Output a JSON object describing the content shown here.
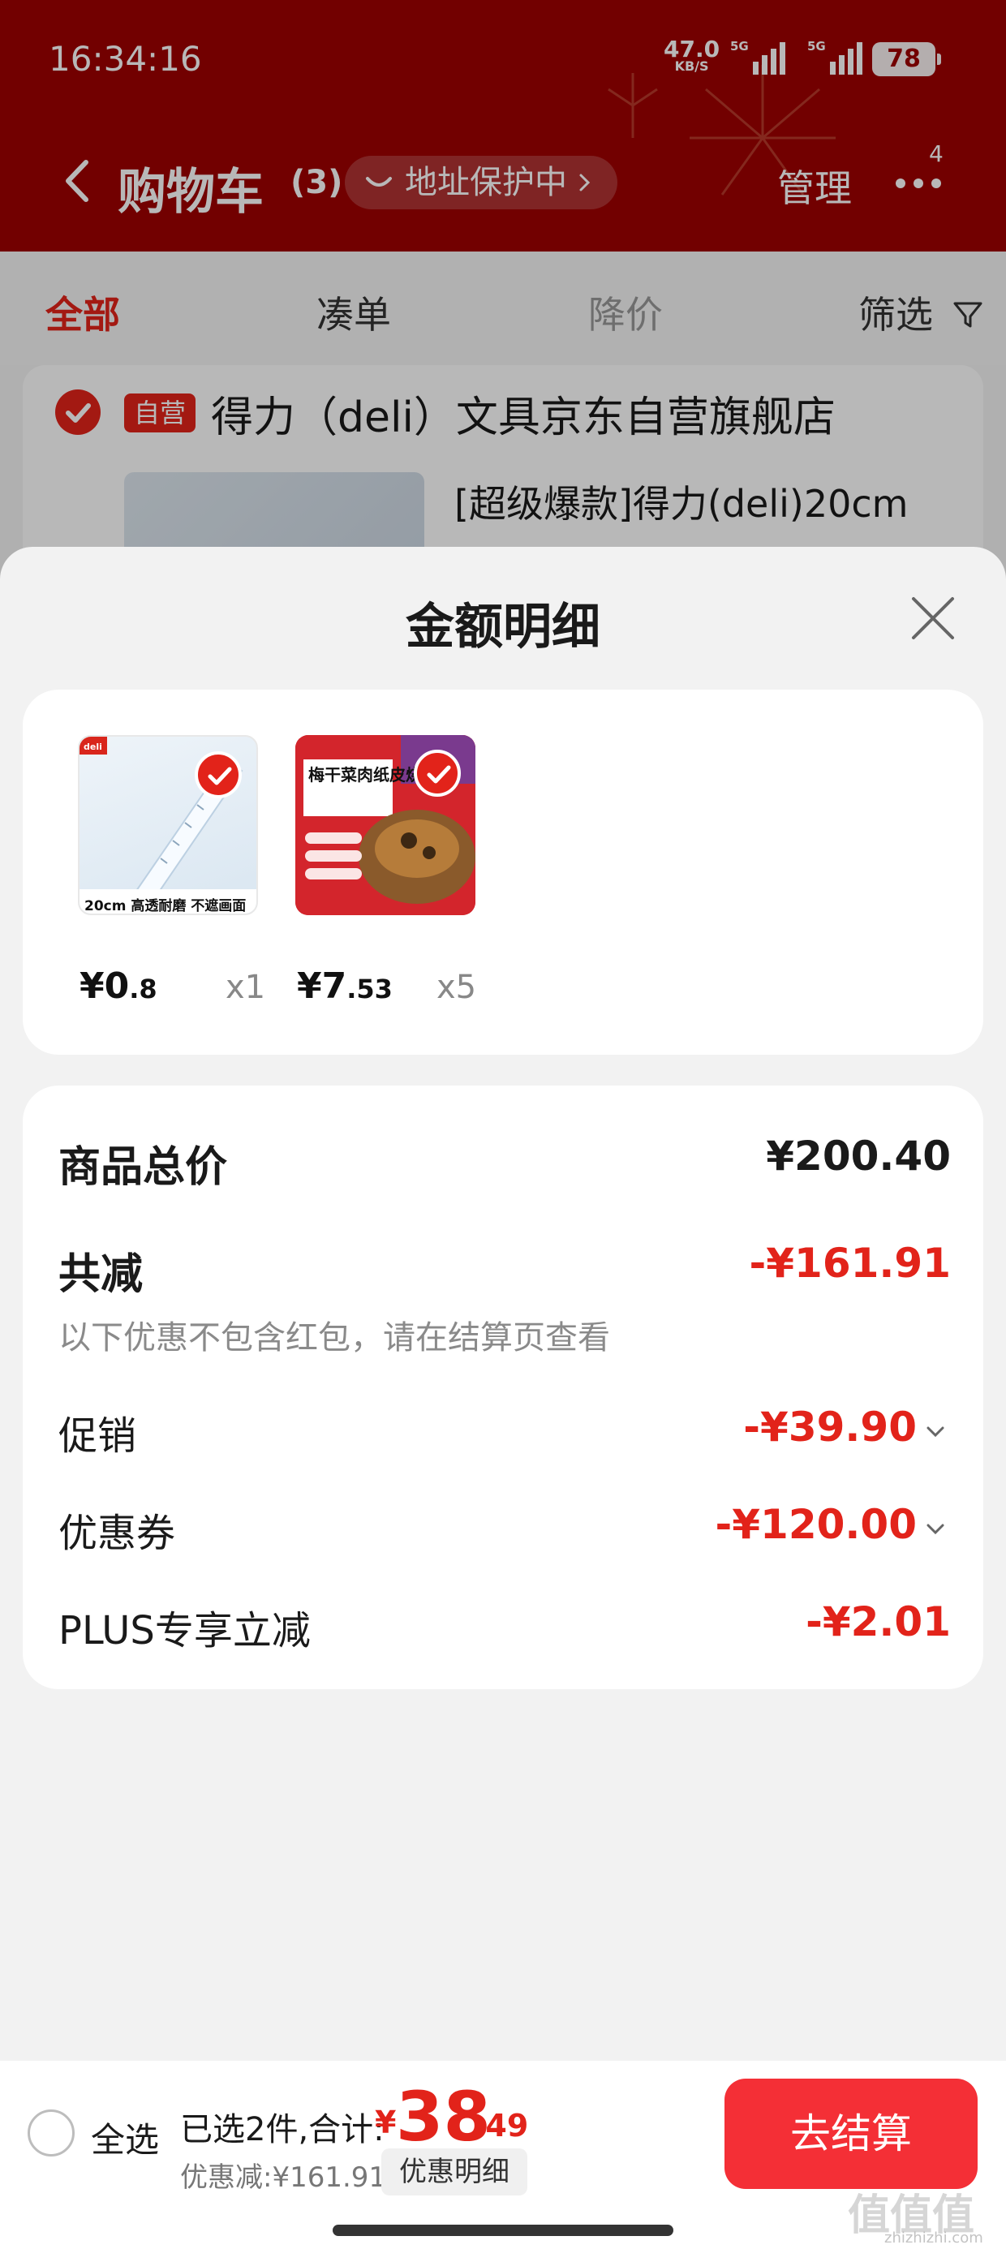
{
  "status_bar": {
    "time": "16:34:16",
    "net_speed": "47.0",
    "net_unit": "KB/S",
    "sig1_label": "5G",
    "sig2_label": "5G",
    "battery": "78"
  },
  "nav": {
    "title": "购物车",
    "count": "(3)",
    "address": "地址保护中",
    "manage": "管理",
    "more_badge": "4"
  },
  "tabs": {
    "all": "全部",
    "combine": "凑单",
    "price_drop": "降价",
    "filter": "筛选"
  },
  "store": {
    "badge": "自营",
    "name": "得力（deli）文具京东自营旗舰店",
    "product_title": "[超级爆款]得力(deli)20cm"
  },
  "sheet": {
    "title": "金额明细",
    "items": [
      {
        "price_int": "¥0",
        "price_dec": ".8",
        "qty": "x1",
        "thumb_text": "20cm 高透耐磨 不遮画面"
      },
      {
        "price_int": "¥7",
        "price_dec": ".53",
        "qty": "x5",
        "thumb_text": "梅干菜肉纸皮烧麦"
      }
    ],
    "total_label": "商品总价",
    "total_value": "¥200.40",
    "reduce_label": "共减",
    "reduce_value": "-¥161.91",
    "note": "以下优惠不包含红包，请在结算页查看",
    "promo_label": "促销",
    "promo_value": "-¥39.90",
    "coupon_label": "优惠券",
    "coupon_value": "-¥120.00",
    "plus_label": "PLUS专享立减",
    "plus_value": "-¥2.01"
  },
  "bottom": {
    "select_all": "全选",
    "selected": "已选2件,合计:",
    "total_yuan": "¥",
    "total_int": "38",
    "total_dec": ".49",
    "discount": "优惠减:¥161.91",
    "detail_button": "优惠明细",
    "checkout": "去结算"
  },
  "watermark": {
    "text": "值值值",
    "sub": "zhizhizhi.com"
  },
  "colors": {
    "header": "#9e0000",
    "accent": "#e2231a",
    "checkout": "#f42f36"
  }
}
